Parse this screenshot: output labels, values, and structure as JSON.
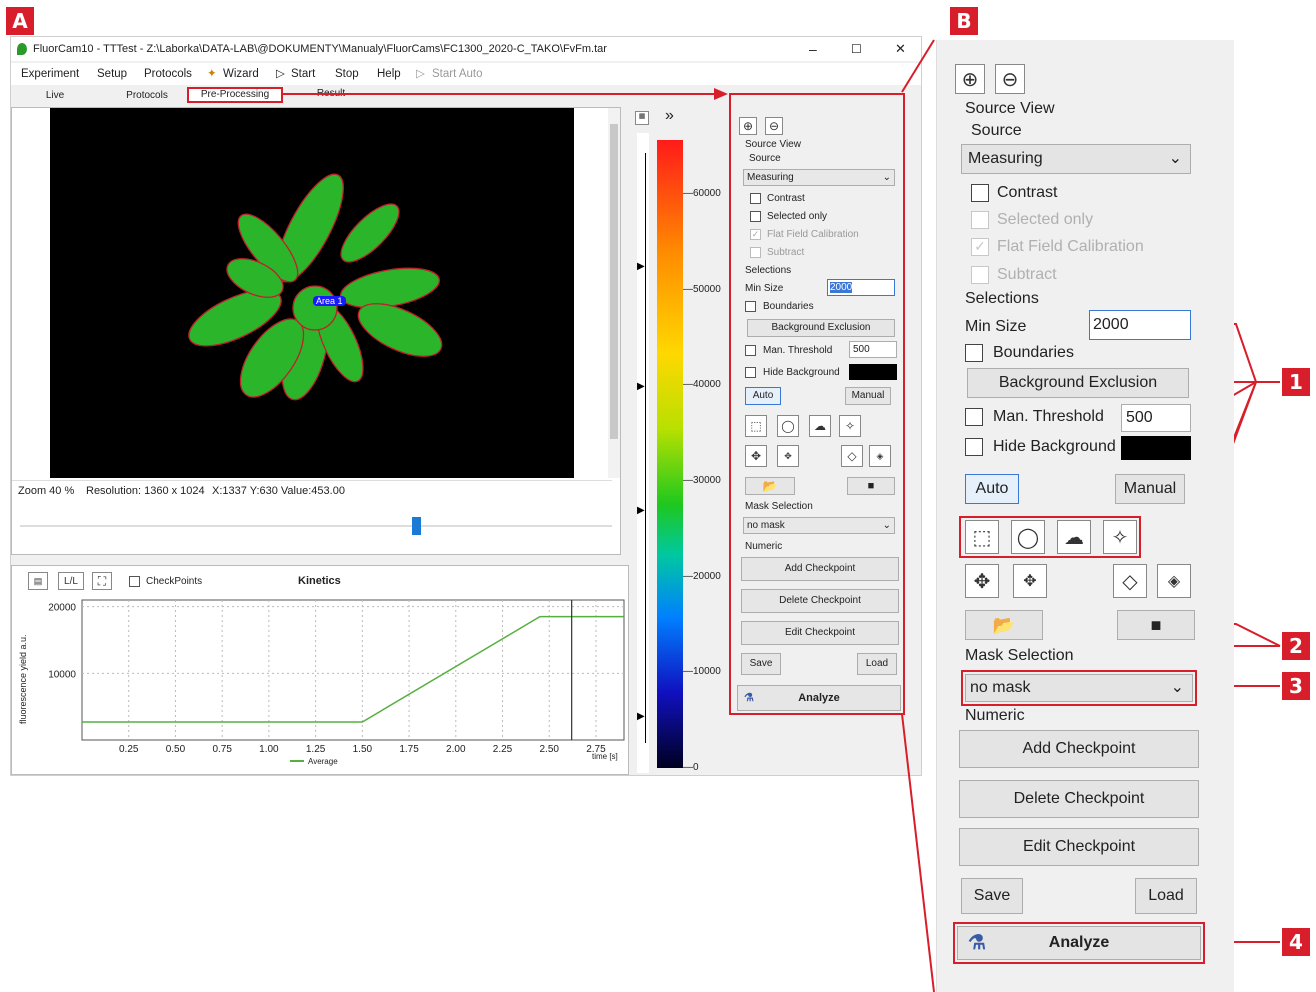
{
  "labels": {
    "a": "A",
    "b": "B"
  },
  "window": {
    "title": "FluorCam10 - TTTest - Z:\\Laborka\\DATA-LAB\\@DOKUMENTY\\Manualy\\FluorCams\\FC1300_2020-C_TAKO\\FvFm.tar",
    "minimize": "–",
    "maximize": "☐",
    "close": "✕"
  },
  "menu": {
    "experiment": "Experiment",
    "setup": "Setup",
    "protocols": "Protocols",
    "wizard": "Wizard",
    "start": "Start",
    "stop": "Stop",
    "help": "Help",
    "start_auto": "Start Auto"
  },
  "tabs": {
    "live": "Live",
    "protocols": "Protocols",
    "preprocessing": "Pre-Processing",
    "result": "Result"
  },
  "image": {
    "area_label": "Area 1"
  },
  "status": {
    "zoom": "Zoom 40 %",
    "resolution": "Resolution: 1360 x 1024",
    "cursor": "X:1337 Y:630 Value:453.00"
  },
  "kinetics": {
    "checkpoints": "CheckPoints",
    "title": "Kinetics",
    "ll": "L/L",
    "ylabel": "fluorescence yield a.u.",
    "xlabel": "time [s]",
    "legend": "Average"
  },
  "colorbar": {
    "ticks": [
      "60000",
      "50000",
      "40000",
      "30000",
      "20000",
      "10000",
      "0"
    ]
  },
  "panel": {
    "source_view": "Source View",
    "source": "Source",
    "source_value": "Measuring",
    "contrast": "Contrast",
    "selected_only": "Selected only",
    "flat_field": "Flat Field Calibration",
    "subtract": "Subtract",
    "selections": "Selections",
    "min_size": "Min Size",
    "min_size_value": "2000",
    "boundaries": "Boundaries",
    "background_exclusion": "Background Exclusion",
    "man_threshold": "Man. Threshold",
    "threshold_value": "500",
    "hide_background": "Hide Background",
    "auto": "Auto",
    "manual": "Manual",
    "mask_selection": "Mask Selection",
    "mask_value": "no mask",
    "numeric": "Numeric",
    "add_checkpoint": "Add Checkpoint",
    "delete_checkpoint": "Delete Checkpoint",
    "edit_checkpoint": "Edit Checkpoint",
    "save": "Save",
    "load": "Load",
    "analyze": "Analyze"
  },
  "callouts": [
    "1",
    "2",
    "3",
    "4"
  ],
  "colors": {
    "accent_red": "#d81e2a",
    "plant_green": "#2bb52b",
    "selection_blue": "#1a1aff"
  },
  "chart_data": {
    "type": "line",
    "title": "Kinetics",
    "xlabel": "time [s]",
    "ylabel": "fluorescence yield a.u.",
    "xlim": [
      0,
      2.9
    ],
    "ylim": [
      0,
      21000
    ],
    "x_ticks": [
      "0.25",
      "0.50",
      "0.75",
      "1.00",
      "1.25",
      "1.50",
      "1.75",
      "2.00",
      "2.25",
      "2.50",
      "2.75"
    ],
    "y_ticks": [
      "20000",
      "10000"
    ],
    "series": [
      {
        "name": "Average",
        "x": [
          0,
          1.5,
          2.45,
          2.9
        ],
        "y": [
          2700,
          2700,
          18500,
          18500
        ]
      }
    ],
    "marker_x": 2.62
  }
}
